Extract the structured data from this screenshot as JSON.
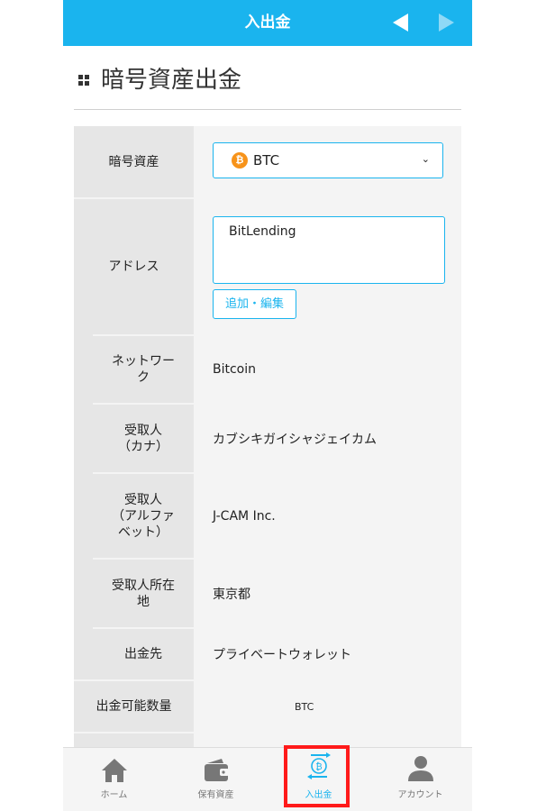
{
  "header": {
    "title": "入出金"
  },
  "section": {
    "title": "暗号資産出金"
  },
  "form": {
    "asset": {
      "label": "暗号資産",
      "selected": "BTC",
      "icon_glyph": "₿"
    },
    "address": {
      "label": "アドレス",
      "value": "BitLending",
      "edit_button": "追加・編集"
    },
    "network": {
      "label": "ネットワーク",
      "value": "Bitcoin"
    },
    "recipient_kana": {
      "label_line1": "受取人",
      "label_line2": "（カナ）",
      "value": "カブシキガイシャジェイカム"
    },
    "recipient_alpha": {
      "label_line1": "受取人",
      "label_line2": "（アルファ",
      "label_line3": "ベット）",
      "value": "J-CAM Inc."
    },
    "recipient_location": {
      "label_line1": "受取人所在",
      "label_line2": "地",
      "value": "東京都"
    },
    "destination": {
      "label": "出金先",
      "value": "プライベートウォレット"
    },
    "available": {
      "label": "出金可能数量",
      "unit": "BTC"
    }
  },
  "bottom_nav": {
    "items": [
      {
        "label": "ホーム",
        "icon": "home-icon"
      },
      {
        "label": "保有資産",
        "icon": "wallet-icon"
      },
      {
        "label": "入出金",
        "icon": "deposit-withdraw-icon",
        "active": true
      },
      {
        "label": "アカウント",
        "icon": "account-icon"
      }
    ]
  },
  "colors": {
    "accent": "#1ab4ee",
    "highlight": "#ff1a1a",
    "btc": "#f7931a"
  }
}
